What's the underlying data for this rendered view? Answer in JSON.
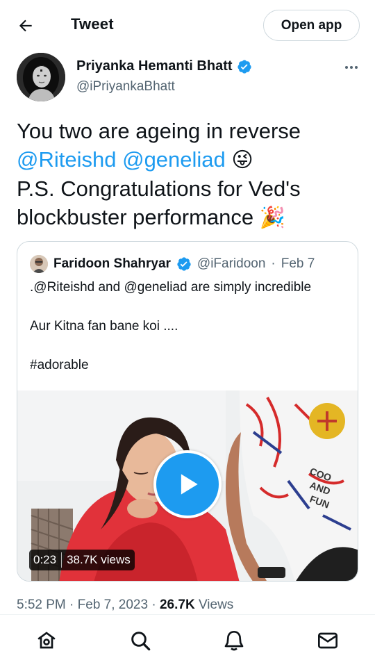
{
  "header": {
    "title": "Tweet",
    "open_app_label": "Open app"
  },
  "tweet": {
    "author_name": "Priyanka Hemanti Bhatt",
    "author_handle": "@iPriyankaBhatt",
    "text_line1": "You two are ageing in reverse",
    "mention1": "@Riteishd",
    "mention2": "@geneliad",
    "emoji1": "😜",
    "text_line3": "P.S. Congratulations for Ved's",
    "text_line4": "blockbuster performance",
    "emoji2": "🎉",
    "time": "5:52 PM",
    "date": "Feb 7, 2023",
    "views_count": "26.7K",
    "views_label": "Views"
  },
  "quoted_tweet": {
    "author_name": "Faridoon Shahryar",
    "author_handle": "@iFaridoon",
    "date": "Feb 7",
    "line1": ".@Riteishd and @geneliad are simply incredible",
    "line2": "Aur Kitna fan bane koi ....",
    "line3": "#adorable",
    "video_duration": "0:23",
    "video_views": "38.7K views"
  },
  "icons": {
    "back": "arrow-left-icon",
    "more": "more-dots-icon",
    "verified": "verified-badge-icon",
    "play": "play-icon",
    "home": "home-icon",
    "search": "search-icon",
    "notifications": "bell-icon",
    "messages": "envelope-icon"
  },
  "colors": {
    "accent": "#1d9bf0",
    "text": "#0f1419",
    "muted": "#536471"
  }
}
